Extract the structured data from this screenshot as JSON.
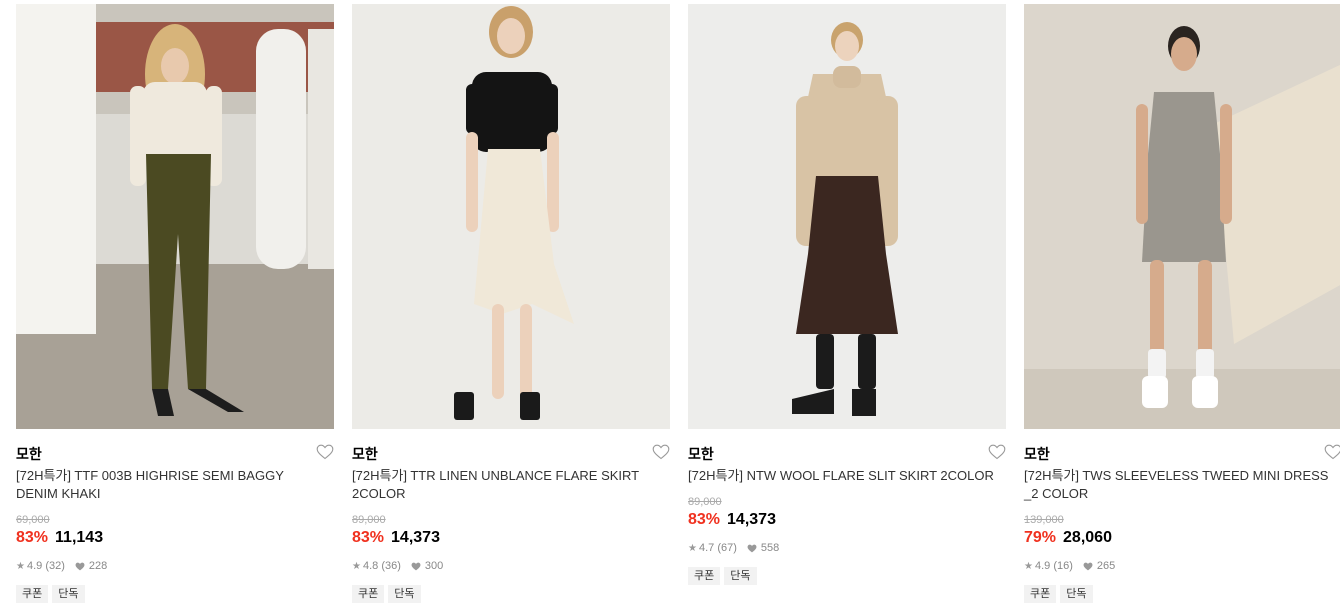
{
  "products": [
    {
      "brand": "모한",
      "title": "[72H특가] TTF 003B HIGHRISE SEMI BAGGY DENIM KHAKI",
      "original_price": "69,000",
      "discount": "83%",
      "price": "11,143",
      "rating": "4.9",
      "review_count": "(32)",
      "likes": "228",
      "tags": [
        "쿠폰",
        "단독"
      ],
      "image_desc": "model in cream turtleneck and khaki jeans",
      "colors": {
        "top": "#efe9dd",
        "bottom": "#4b4a22",
        "bg": "#d7d4cc"
      }
    },
    {
      "brand": "모한",
      "title": "[72H특가] TTR LINEN UNBLANCE FLARE SKIRT 2COLOR",
      "original_price": "89,000",
      "discount": "83%",
      "price": "14,373",
      "rating": "4.8",
      "review_count": "(36)",
      "likes": "300",
      "tags": [
        "쿠폰",
        "단독"
      ],
      "image_desc": "model in black top and cream flare skirt",
      "colors": {
        "top": "#141414",
        "bottom": "#f0e8d8",
        "bg": "#ecebe7"
      }
    },
    {
      "brand": "모한",
      "title": "[72H특가] NTW WOOL FLARE SLIT SKIRT 2COLOR",
      "original_price": "89,000",
      "discount": "83%",
      "price": "14,373",
      "rating": "4.7",
      "review_count": "(67)",
      "likes": "558",
      "tags": [
        "쿠폰",
        "단독"
      ],
      "image_desc": "model in beige knit and brown skirt",
      "colors": {
        "top": "#d8c3a5",
        "bottom": "#3b2720",
        "bg": "#ededeb"
      }
    },
    {
      "brand": "모한",
      "title": "[72H특가] TWS SLEEVELESS TWEED MINI DRESS _2 COLOR",
      "original_price": "139,000",
      "discount": "79%",
      "price": "28,060",
      "rating": "4.9",
      "review_count": "(16)",
      "likes": "265",
      "tags": [
        "쿠폰",
        "단독"
      ],
      "image_desc": "model in tweed mini dress",
      "colors": {
        "top": "#9a968e",
        "bottom": "#8e8a82",
        "bg": "#dcd6cc"
      }
    }
  ]
}
